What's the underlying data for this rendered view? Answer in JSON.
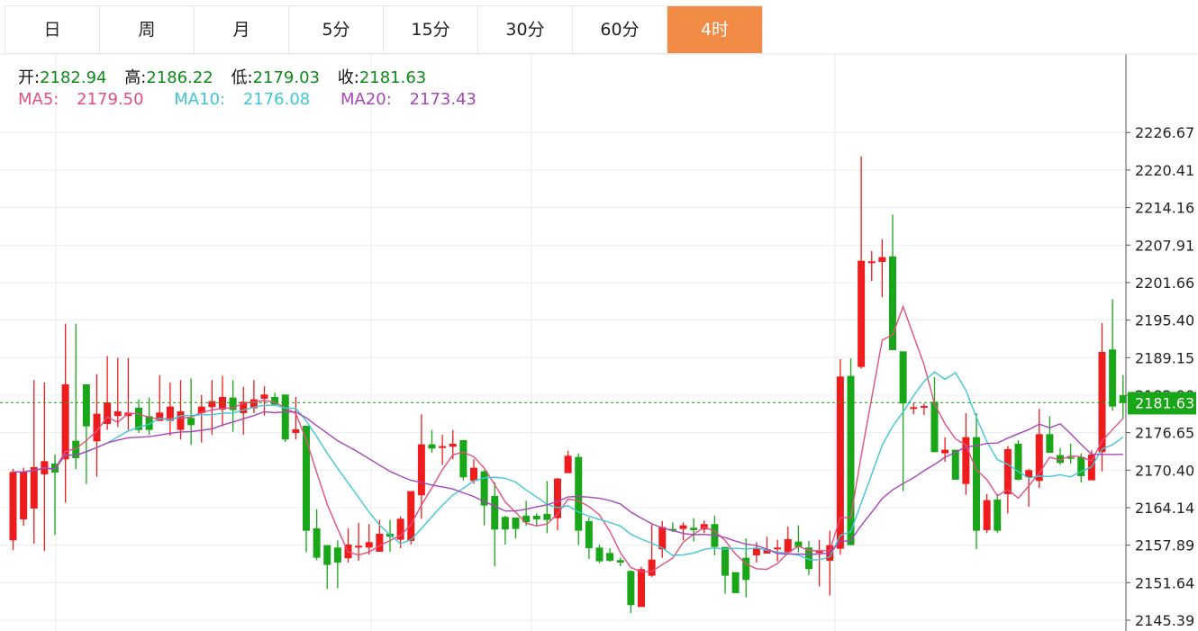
{
  "tabs": [
    {
      "label": "日",
      "active": false
    },
    {
      "label": "周",
      "active": false
    },
    {
      "label": "月",
      "active": false
    },
    {
      "label": "5分",
      "active": false
    },
    {
      "label": "15分",
      "active": false
    },
    {
      "label": "30分",
      "active": false
    },
    {
      "label": "60分",
      "active": false
    },
    {
      "label": "4时",
      "active": true
    }
  ],
  "ohlc": {
    "open_label": "开:",
    "open": "2182.94",
    "high_label": "高:",
    "high": "2186.22",
    "low_label": "低:",
    "low": "2179.03",
    "close_label": "收:",
    "close": "2181.63"
  },
  "ma": {
    "ma5_label": "MA5:",
    "ma5": "2179.50",
    "ma10_label": "MA10:",
    "ma10": "2176.08",
    "ma20_label": "MA20:",
    "ma20": "2173.43"
  },
  "colors": {
    "up": "#ee1c1c",
    "down": "#19a619",
    "ma5": "#e24f80",
    "ma10": "#3ec6d6",
    "ma20": "#a646b8",
    "tab_active": "#f18b45",
    "last_price": "#19a619"
  },
  "chart_data": {
    "type": "candlestick",
    "yticks": [
      "2226.67",
      "2220.41",
      "2214.16",
      "2207.91",
      "2201.66",
      "2195.40",
      "2189.15",
      "2182.90",
      "2176.65",
      "2170.40",
      "2164.14",
      "2157.89",
      "2151.64",
      "2145.39"
    ],
    "ylim": [
      2145.39,
      2226.67
    ],
    "grid": true,
    "last_price": "2181.63",
    "candles": [
      [
        2158.7,
        2170.1,
        2157.1,
        2170.6
      ],
      [
        2162.2,
        2170.1,
        2161.1,
        2170.8
      ],
      [
        2164.0,
        2170.9,
        2158.1,
        2185.4
      ],
      [
        2169.7,
        2171.9,
        2156.9,
        2185.0
      ],
      [
        2171.5,
        2170.0,
        2159.6,
        2173.0
      ],
      [
        2172.2,
        2184.7,
        2165.0,
        2194.8
      ],
      [
        2175.3,
        2172.4,
        2170.6,
        2194.8
      ],
      [
        2184.7,
        2177.7,
        2168.1,
        2184.7
      ],
      [
        2175.2,
        2179.8,
        2169.3,
        2186.4
      ],
      [
        2178.1,
        2181.7,
        2177.1,
        2189.4
      ],
      [
        2179.4,
        2180.2,
        2177.6,
        2189.1
      ],
      [
        2179.4,
        2180.0,
        2177.1,
        2189.1
      ],
      [
        2180.8,
        2177.1,
        2176.6,
        2182.2
      ],
      [
        2179.4,
        2177.1,
        2176.3,
        2182.5
      ],
      [
        2178.6,
        2180.0,
        2178.6,
        2186.2
      ],
      [
        2178.6,
        2181.0,
        2176.1,
        2185.0
      ],
      [
        2177.1,
        2180.2,
        2175.5,
        2185.4
      ],
      [
        2179.1,
        2177.9,
        2174.6,
        2185.7
      ],
      [
        2179.9,
        2181.0,
        2175.0,
        2182.9
      ],
      [
        2180.9,
        2181.9,
        2176.3,
        2185.4
      ],
      [
        2180.5,
        2182.6,
        2177.7,
        2186.1
      ],
      [
        2182.5,
        2180.4,
        2176.8,
        2185.4
      ],
      [
        2179.9,
        2181.8,
        2176.3,
        2184.3
      ],
      [
        2180.7,
        2182.2,
        2179.9,
        2185.4
      ],
      [
        2182.3,
        2183.0,
        2179.5,
        2184.4
      ],
      [
        2182.6,
        2181.3,
        2181.1,
        2183.3
      ],
      [
        2183.0,
        2175.5,
        2175.1,
        2183.0
      ],
      [
        2176.6,
        2177.2,
        2175.5,
        2182.6
      ],
      [
        2177.8,
        2160.3,
        2156.7,
        2177.8
      ],
      [
        2160.7,
        2155.8,
        2155.4,
        2163.9
      ],
      [
        2157.9,
        2154.6,
        2150.6,
        2157.9
      ],
      [
        2157.5,
        2155.0,
        2150.7,
        2158.7
      ],
      [
        2155.7,
        2158.0,
        2155.0,
        2160.7
      ],
      [
        2157.5,
        2157.8,
        2155.3,
        2161.6
      ],
      [
        2157.5,
        2158.4,
        2156.3,
        2161.4
      ],
      [
        2156.8,
        2159.8,
        2157.4,
        2162.1
      ],
      [
        2159.8,
        2159.3,
        2156.8,
        2162.1
      ],
      [
        2158.8,
        2162.3,
        2157.4,
        2162.7
      ],
      [
        2158.6,
        2166.9,
        2158.0,
        2166.9
      ],
      [
        2166.2,
        2174.7,
        2162.3,
        2179.7
      ],
      [
        2174.7,
        2174.0,
        2173.3,
        2177.1
      ],
      [
        2174.1,
        2174.4,
        2171.3,
        2176.3
      ],
      [
        2174.3,
        2174.8,
        2172.2,
        2177.1
      ],
      [
        2175.4,
        2169.2,
        2168.7,
        2175.3
      ],
      [
        2168.6,
        2170.8,
        2168.1,
        2172.2
      ],
      [
        2170.2,
        2164.5,
        2161.2,
        2170.4
      ],
      [
        2166.1,
        2160.5,
        2154.4,
        2168.4
      ],
      [
        2162.6,
        2160.5,
        2158.0,
        2162.8
      ],
      [
        2162.5,
        2160.6,
        2159.0,
        2162.4
      ],
      [
        2162.8,
        2161.7,
        2161.1,
        2165.3
      ],
      [
        2162.8,
        2162.2,
        2161.2,
        2163.2
      ],
      [
        2163.1,
        2162.1,
        2159.9,
        2168.6
      ],
      [
        2162.4,
        2169.0,
        2160.4,
        2169.1
      ],
      [
        2169.9,
        2172.8,
        2170.3,
        2173.6
      ],
      [
        2172.6,
        2160.3,
        2157.9,
        2173.2
      ],
      [
        2161.9,
        2157.4,
        2155.6,
        2162.5
      ],
      [
        2157.5,
        2155.2,
        2154.9,
        2158.0
      ],
      [
        2156.6,
        2155.3,
        2155.1,
        2157.4
      ],
      [
        2155.4,
        2155.0,
        2154.4,
        2155.8
      ],
      [
        2153.6,
        2147.9,
        2146.6,
        2153.7
      ],
      [
        2147.6,
        2153.9,
        2147.7,
        2154.3
      ],
      [
        2152.8,
        2155.5,
        2152.6,
        2161.3
      ],
      [
        2157.2,
        2160.9,
        2155.8,
        2161.9
      ],
      [
        2160.6,
        2160.5,
        2160.1,
        2161.7
      ],
      [
        2160.6,
        2161.2,
        2158.7,
        2161.7
      ],
      [
        2160.8,
        2160.4,
        2158.5,
        2162.4
      ],
      [
        2160.5,
        2161.4,
        2159.9,
        2162.0
      ],
      [
        2161.4,
        2157.6,
        2156.2,
        2162.8
      ],
      [
        2157.6,
        2152.8,
        2149.8,
        2157.4
      ],
      [
        2153.4,
        2149.9,
        2149.9,
        2153.3
      ],
      [
        2155.8,
        2152.1,
        2149.2,
        2159.0
      ],
      [
        2156.2,
        2157.4,
        2155.0,
        2158.4
      ],
      [
        2156.5,
        2157.2,
        2156.5,
        2159.3
      ],
      [
        2157.5,
        2157.5,
        2155.2,
        2158.8
      ],
      [
        2156.7,
        2158.9,
        2156.4,
        2161.0
      ],
      [
        2158.5,
        2157.6,
        2156.7,
        2161.2
      ],
      [
        2157.5,
        2153.9,
        2152.9,
        2158.6
      ],
      [
        2156.9,
        2156.9,
        2151.0,
        2158.8
      ],
      [
        2155.3,
        2157.9,
        2149.5,
        2160.3
      ],
      [
        2157.3,
        2186.0,
        2156.3,
        2188.9
      ],
      [
        2186.1,
        2157.9,
        2157.9,
        2189.0
      ],
      [
        2187.6,
        2205.3,
        2187.3,
        2222.7
      ],
      [
        2205.2,
        2205.2,
        2201.9,
        2206.9
      ],
      [
        2205.1,
        2205.9,
        2199.2,
        2208.9
      ],
      [
        2206.0,
        2190.4,
        2191.2,
        2213.0
      ],
      [
        2190.2,
        2181.5,
        2166.9,
        2190.1
      ],
      [
        2180.9,
        2180.9,
        2179.7,
        2181.6
      ],
      [
        2180.8,
        2181.1,
        2179.6,
        2181.5
      ],
      [
        2181.8,
        2173.4,
        2173.4,
        2185.9
      ],
      [
        2173.2,
        2173.8,
        2171.8,
        2175.9
      ],
      [
        2173.8,
        2168.8,
        2168.9,
        2172.2
      ],
      [
        2168.1,
        2175.9,
        2166.3,
        2179.9
      ],
      [
        2175.9,
        2160.3,
        2157.2,
        2179.9
      ],
      [
        2160.4,
        2165.4,
        2159.9,
        2166.4
      ],
      [
        2165.5,
        2160.3,
        2159.9,
        2166.4
      ],
      [
        2166.4,
        2173.9,
        2163.2,
        2174.4
      ],
      [
        2174.8,
        2168.8,
        2168.7,
        2175.4
      ],
      [
        2169.2,
        2170.4,
        2164.3,
        2170.6
      ],
      [
        2168.6,
        2176.4,
        2167.4,
        2180.6
      ],
      [
        2176.4,
        2173.3,
        2173.7,
        2179.4
      ],
      [
        2172.9,
        2171.6,
        2171.3,
        2174.1
      ],
      [
        2172.6,
        2172.3,
        2171.5,
        2174.8
      ],
      [
        2172.6,
        2169.4,
        2168.3,
        2173.2
      ],
      [
        2168.7,
        2173.0,
        2170.1,
        2173.7
      ],
      [
        2173.4,
        2190.1,
        2170.2,
        2194.9
      ],
      [
        2190.5,
        2181.0,
        2180.3,
        2198.9
      ],
      [
        2182.9,
        2181.6,
        2179.0,
        2186.2
      ]
    ]
  }
}
